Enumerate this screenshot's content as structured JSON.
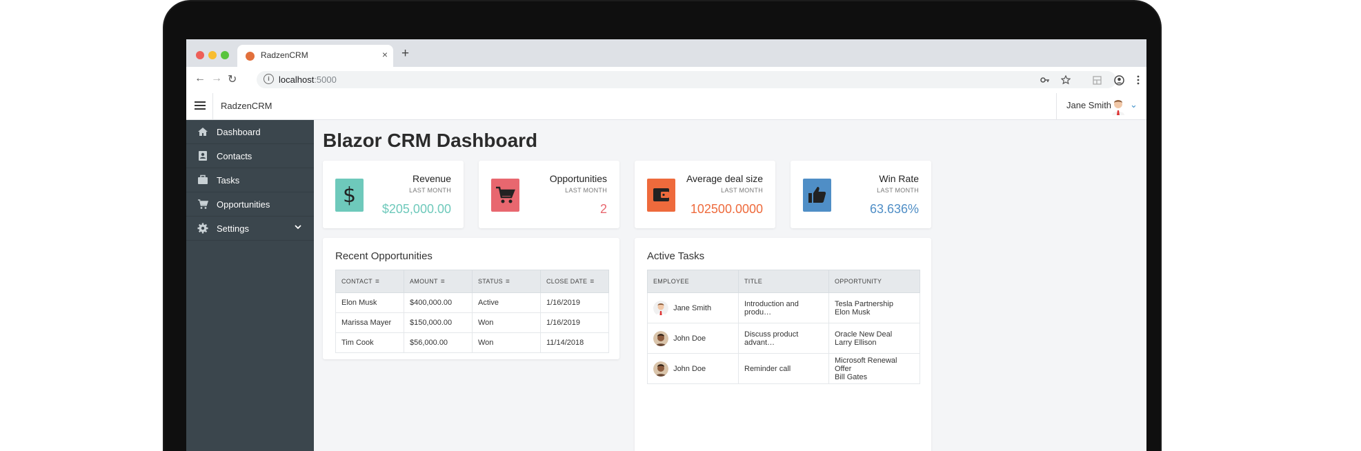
{
  "browser": {
    "tab_title": "RadzenCRM",
    "tab_close": "×",
    "new_tab": "+",
    "url_host": "localhost",
    "url_port": ":5000",
    "back": "←",
    "forward": "→",
    "reload": "↻"
  },
  "header": {
    "brand": "RadzenCRM",
    "user_name": "Jane Smith"
  },
  "sidebar": {
    "items": [
      {
        "label": "Dashboard",
        "icon": "home-icon"
      },
      {
        "label": "Contacts",
        "icon": "contacts-icon"
      },
      {
        "label": "Tasks",
        "icon": "briefcase-icon"
      },
      {
        "label": "Opportunities",
        "icon": "cart-icon"
      },
      {
        "label": "Settings",
        "icon": "gear-icon"
      }
    ]
  },
  "main": {
    "title": "Blazor CRM Dashboard",
    "stats": [
      {
        "title": "Revenue",
        "sub": "LAST MONTH",
        "value": "$205,000.00",
        "color": "#6ec9bb",
        "icon": "dollar-icon"
      },
      {
        "title": "Opportunities",
        "sub": "LAST MONTH",
        "value": "2",
        "color": "#e8676f",
        "icon": "cart-icon"
      },
      {
        "title": "Average deal size",
        "sub": "LAST MONTH",
        "value": "102500.0000",
        "color": "#ee6a3c",
        "icon": "wallet-icon"
      },
      {
        "title": "Win Rate",
        "sub": "LAST MONTH",
        "value": "63.636%",
        "color": "#4f8ec6",
        "icon": "thumbs-up-icon"
      }
    ],
    "recent": {
      "title": "Recent Opportunities",
      "columns": [
        "CONTACT",
        "AMOUNT",
        "STATUS",
        "CLOSE DATE"
      ],
      "rows": [
        [
          "Elon Musk",
          "$400,000.00",
          "Active",
          "1/16/2019"
        ],
        [
          "Marissa Mayer",
          "$150,000.00",
          "Won",
          "1/16/2019"
        ],
        [
          "Tim Cook",
          "$56,000.00",
          "Won",
          "11/14/2018"
        ]
      ]
    },
    "tasks": {
      "title": "Active Tasks",
      "columns": [
        "EMPLOYEE",
        "TITLE",
        "OPPORTUNITY"
      ],
      "rows": [
        {
          "employee": "Jane Smith",
          "title": "Introduction and produ…",
          "opp1": "Tesla Partnership",
          "opp2": "Elon Musk"
        },
        {
          "employee": "John Doe",
          "title": "Discuss product advant…",
          "opp1": "Oracle New Deal",
          "opp2": "Larry Ellison"
        },
        {
          "employee": "John Doe",
          "title": "Reminder call",
          "opp1": "Microsoft Renewal Offer",
          "opp2": "Bill Gates"
        }
      ]
    }
  }
}
